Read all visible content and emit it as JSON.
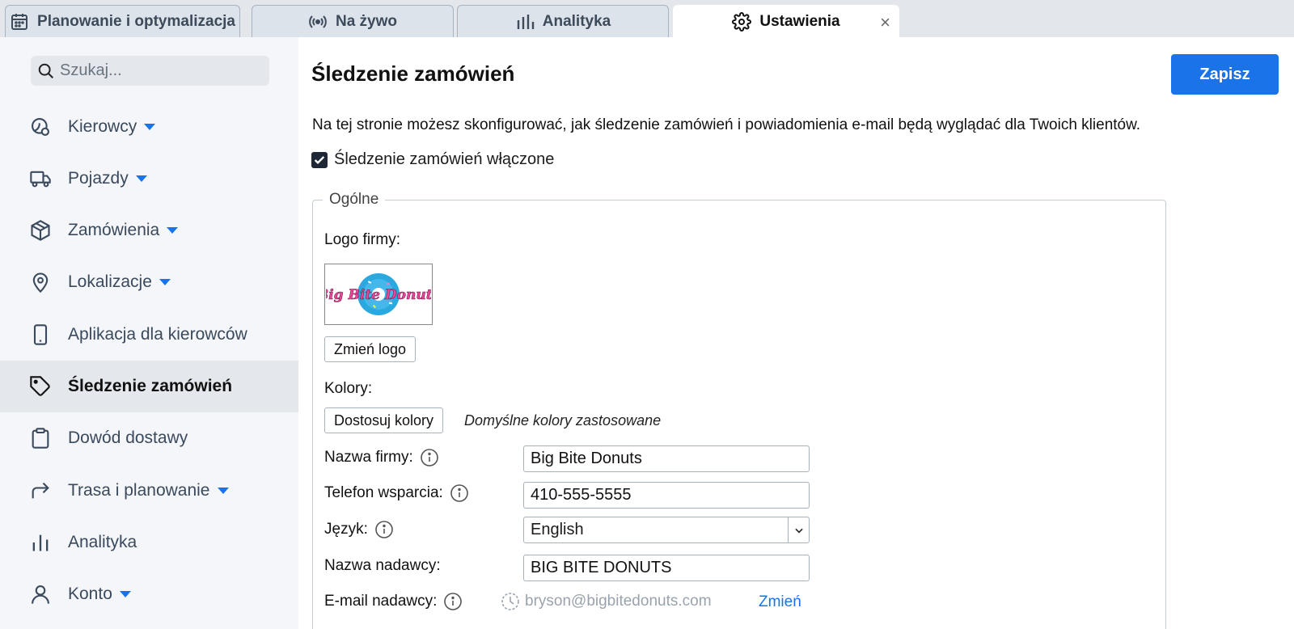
{
  "tabs": [
    {
      "label": "Planowanie i optymalizacja",
      "icon": "calendar-icon"
    },
    {
      "label": "Na żywo",
      "icon": "broadcast-icon"
    },
    {
      "label": "Analityka",
      "icon": "bar-chart-icon"
    },
    {
      "label": "Ustawienia",
      "icon": "gear-icon",
      "active": true
    }
  ],
  "tab_close": "×",
  "sidebar": {
    "search_placeholder": "Szukaj...",
    "items": [
      {
        "label": "Kierowcy",
        "icon": "drivers-icon",
        "caret": true
      },
      {
        "label": "Pojazdy",
        "icon": "truck-icon",
        "caret": true
      },
      {
        "label": "Zamówienia",
        "icon": "box-icon",
        "caret": true
      },
      {
        "label": "Lokalizacje",
        "icon": "map-pin-icon",
        "caret": true
      },
      {
        "label": "Aplikacja dla kierowców",
        "icon": "phone-icon",
        "caret": false
      },
      {
        "label": "Śledzenie zamówień",
        "icon": "tag-icon",
        "caret": false,
        "active": true
      },
      {
        "label": "Dowód dostawy",
        "icon": "clipboard-icon",
        "caret": false
      },
      {
        "label": "Trasa i planowanie",
        "icon": "route-arrow-icon",
        "caret": true
      },
      {
        "label": "Analityka",
        "icon": "analytics-icon",
        "caret": false
      },
      {
        "label": "Konto",
        "icon": "user-icon",
        "caret": true
      }
    ]
  },
  "main": {
    "title": "Śledzenie zamówień",
    "save_label": "Zapisz",
    "description": "Na tej stronie możesz skonfigurować, jak śledzenie zamówień i powiadomienia e-mail będą wyglądać dla Twoich klientów.",
    "enabled_label": "Śledzenie zamówień włączone",
    "general": {
      "legend": "Ogólne",
      "logo_label": "Logo firmy:",
      "change_logo": "Zmień logo",
      "colors_label": "Kolory:",
      "customize_colors": "Dostosuj kolory",
      "colors_status": "Domyślne kolory zastosowane",
      "company_name_label": "Nazwa firmy:",
      "company_name_value": "Big Bite Donuts",
      "support_phone_label": "Telefon wsparcia:",
      "support_phone_value": "410-555-5555",
      "language_label": "Język:",
      "language_value": "English",
      "sender_name_label": "Nazwa nadawcy:",
      "sender_name_value": "BIG BITE DONUTS",
      "sender_email_label": "E-mail nadawcy:",
      "sender_email_value": "bryson@bigbitedonuts.com",
      "change_email": "Zmień"
    }
  },
  "colors": {
    "accent": "#1a73e8",
    "sidebar_bg": "#f4f6f9",
    "active_bg": "#e4e8ed",
    "logo_pink": "#e8489a",
    "logo_blue": "#2aa8e0"
  }
}
